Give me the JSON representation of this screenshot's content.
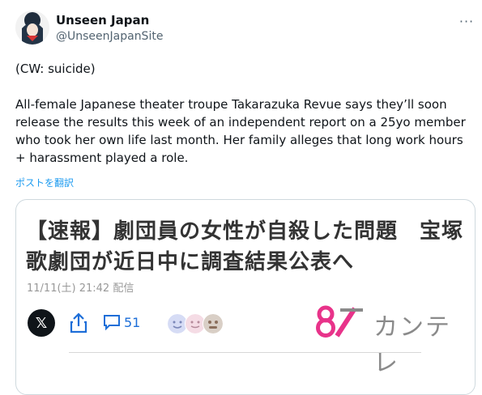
{
  "author": {
    "display_name": "Unseen Japan",
    "handle": "@UnseenJapanSite"
  },
  "tweet": {
    "paragraph_1": "(CW: suicide)",
    "paragraph_2": "All-female Japanese theater troupe Takarazuka Revue says they’ll soon release the results this week of an independent report on a 25yo member who took her own life last month. Her family alleges that long work hours + harassment played a role.",
    "translate_label": "ポストを翻訳"
  },
  "card": {
    "headline": "【速報】劇団員の女性が自殺した問題　宝塚歌劇団が近日中に調査結果公表へ",
    "date": "11/11(土) 21:42 配信",
    "comment_count": "51",
    "x_label": "𝕏",
    "logo_text": "カンテレ"
  },
  "icons": {
    "more": "more-horizontal-icon",
    "share": "share-icon",
    "comment": "comment-icon"
  },
  "colors": {
    "accent": "#1d9bf0",
    "link_blue": "#1d6ed8",
    "logo_pink": "#e8338a"
  }
}
